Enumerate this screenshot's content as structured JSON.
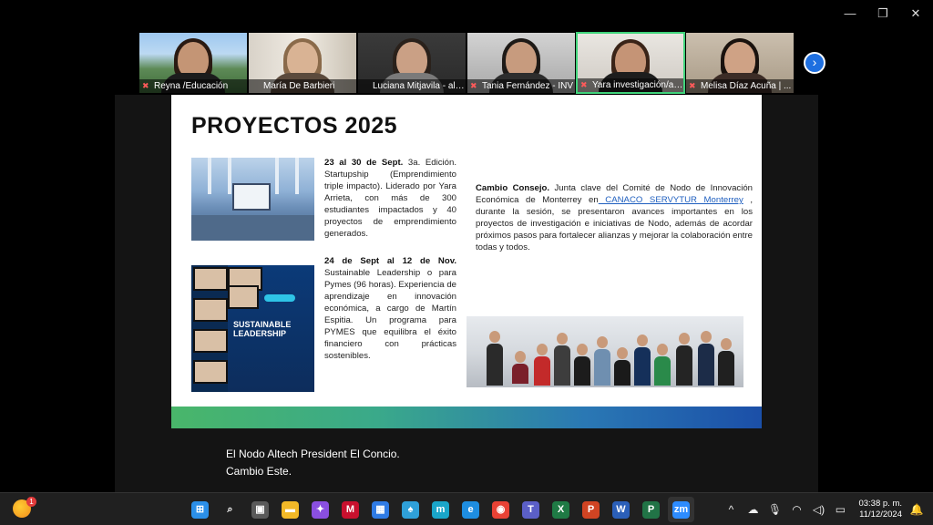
{
  "window": {
    "minimize_glyph": "—",
    "maximize_glyph": "❐",
    "close_glyph": "✕"
  },
  "participants": [
    {
      "name": "Reyna /Educación",
      "muted": true
    },
    {
      "name": "María De Barbieri",
      "muted": false
    },
    {
      "name": "Luciana Mitjavila - alianz...",
      "muted": false
    },
    {
      "name": "Tania Fernández - INV",
      "muted": true
    },
    {
      "name": "Yara investigación/alianz...",
      "muted": true,
      "active": true
    },
    {
      "name": "Melisa Díaz Acuña | ...",
      "muted": true
    }
  ],
  "next_page_glyph": "›",
  "slide": {
    "title": "PROYECTOS 2025",
    "block1_bold": "23 al 30 de Sept.",
    "block1_text": " 3a. Edición. Startupship (Emprendimiento triple impacto). Liderado por Yara Arrieta, con más de 300 estudiantes impactados y 40 proyectos de emprendimiento generados.",
    "block2_bold": "24 de Sept al 12 de Nov.",
    "block2_text": " Sustainable Leadership o para Pymes (96 horas). Experiencia de aprendizaje en innovación económica, a cargo de Martín Espitia. Un programa para PYMES que equilibra el éxito financiero con prácticas sostenibles.",
    "block3_bold": "Cambio Consejo.",
    "block3_text_a": " Junta clave del Comité de Nodo de Innovación Económica de Monterrey en",
    "block3_link": " CANACO SERVYTUR Monterrey",
    "block3_text_b": " , durante la sesión, se presentaron avances importantes en los proyectos de investigación e iniciativas de Nodo, además de acordar próximos pasos para fortalecer alianzas y mejorar la colaboración entre todas y todos.",
    "poster_title": "SUSTAINABLE LEADERSHIP"
  },
  "captions": {
    "line1": "El Nodo Altech President El Concio.",
    "line2": "Cambio Este."
  },
  "taskbar": {
    "weather_badge": "1",
    "apps": [
      {
        "name": "start",
        "glyph": "⊞",
        "color": "#2b8fe8"
      },
      {
        "name": "search",
        "glyph": "⌕",
        "color": "#202020"
      },
      {
        "name": "task-view",
        "glyph": "▣",
        "color": "#5a5a5a"
      },
      {
        "name": "file-explorer",
        "glyph": "▬",
        "color": "#f2b928"
      },
      {
        "name": "copilot",
        "glyph": "✦",
        "color": "#8a4fe0"
      },
      {
        "name": "mcafee",
        "glyph": "M",
        "color": "#c8102e"
      },
      {
        "name": "store",
        "glyph": "▦",
        "color": "#2f7be5"
      },
      {
        "name": "solitaire",
        "glyph": "♠",
        "color": "#2fa0d8"
      },
      {
        "name": "mulpa",
        "glyph": "m",
        "color": "#1aa6c9"
      },
      {
        "name": "edge",
        "glyph": "e",
        "color": "#1e8de0"
      },
      {
        "name": "chrome",
        "glyph": "◉",
        "color": "#e94235"
      },
      {
        "name": "teams",
        "glyph": "T",
        "color": "#5b5fc7"
      },
      {
        "name": "excel",
        "glyph": "X",
        "color": "#1f7a45"
      },
      {
        "name": "powerpoint",
        "glyph": "P",
        "color": "#d04423"
      },
      {
        "name": "word",
        "glyph": "W",
        "color": "#2b5fb8"
      },
      {
        "name": "project",
        "glyph": "P",
        "color": "#217346"
      },
      {
        "name": "zoom",
        "glyph": "zm",
        "color": "#2d8cff"
      }
    ],
    "tray": {
      "chevron": "^",
      "wifi": "◠",
      "volume": "◁)",
      "battery": "▭",
      "mic": "🎙",
      "time": "03:38 p. m.",
      "date": "11/12/2024",
      "bell": "🔔"
    }
  }
}
